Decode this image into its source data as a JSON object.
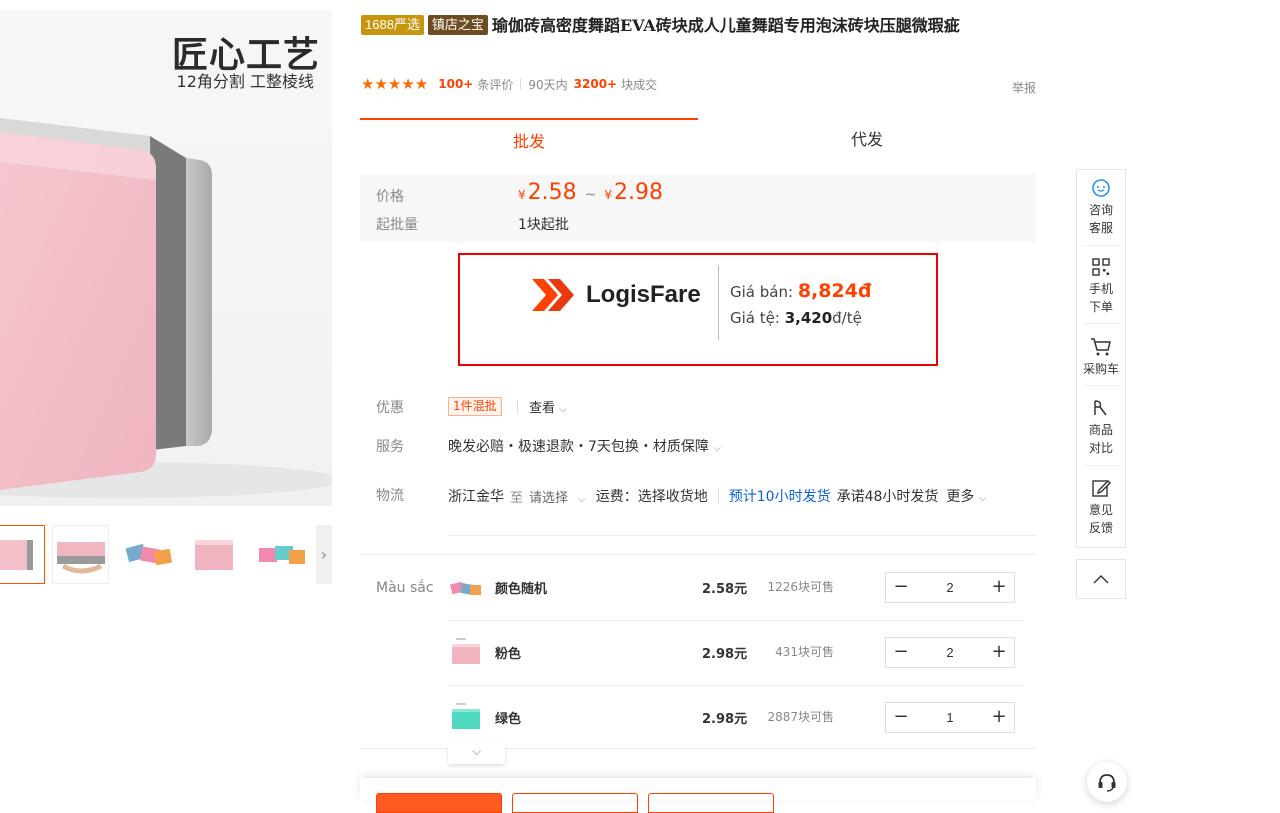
{
  "gallery": {
    "promo_title": "匠心工艺",
    "promo_subtitle": "12角分割 工整棱线"
  },
  "product": {
    "tag_1688": "1688严选",
    "tag_shop": "镇店之宝",
    "title": "瑜伽砖高密度舞蹈EVA砖块成人儿童舞蹈专用泡沫砖块压腿微瑕疵",
    "stars": "★★★★★",
    "review_count": "100+",
    "review_label": "条评价",
    "period_label": "90天内",
    "sold_count": "3200+",
    "sold_label": "块成交",
    "report_label": "举报"
  },
  "tabs": [
    {
      "label": "批发"
    },
    {
      "label": "代发"
    }
  ],
  "pricing": {
    "price_label": "价格",
    "currency": "¥",
    "price_min": "2.58",
    "price_sep": "~",
    "price_max": "2.98",
    "moq_label": "起批量",
    "moq_value": "1块起批"
  },
  "logisfare": {
    "brand": "LogisFare",
    "sell_label": "Giá bán:",
    "sell_value": "8,824đ",
    "rate_label": "Giá tệ:",
    "rate_value": "3,420",
    "rate_unit": "đ/tệ",
    "brand_color": "#ff4000"
  },
  "promo": {
    "label": "优惠",
    "tag": "1件混批",
    "view_label": "查看"
  },
  "service": {
    "label": "服务",
    "text": "晚发必赔・极速退款・7天包换・材质保障"
  },
  "logistics": {
    "label": "物流",
    "origin": "浙江金华",
    "to": "至",
    "select": "请选择",
    "fee": "运费：选择收货地",
    "eta": "预计10小时发货",
    "promise": "承诺48小时发货",
    "more": "更多"
  },
  "variants": {
    "label": "Màu sắc",
    "items": [
      {
        "name": "颜色随机",
        "price": "2.58元",
        "stock": "1226块可售",
        "qty": "2"
      },
      {
        "name": "粉色",
        "price": "2.98元",
        "stock": "431块可售",
        "qty": "2"
      },
      {
        "name": "绿色",
        "price": "2.98元",
        "stock": "2887块可售",
        "qty": "1"
      }
    ]
  },
  "sidebar": {
    "items": [
      {
        "label": "咨询客服",
        "icon": "chat-bubble-icon"
      },
      {
        "label": "手机下单",
        "icon": "qr-code-icon"
      },
      {
        "label": "采购车",
        "icon": "cart-icon"
      },
      {
        "label": "商品对比",
        "icon": "compare-icon"
      },
      {
        "label": "意见反馈",
        "icon": "edit-icon"
      }
    ]
  }
}
